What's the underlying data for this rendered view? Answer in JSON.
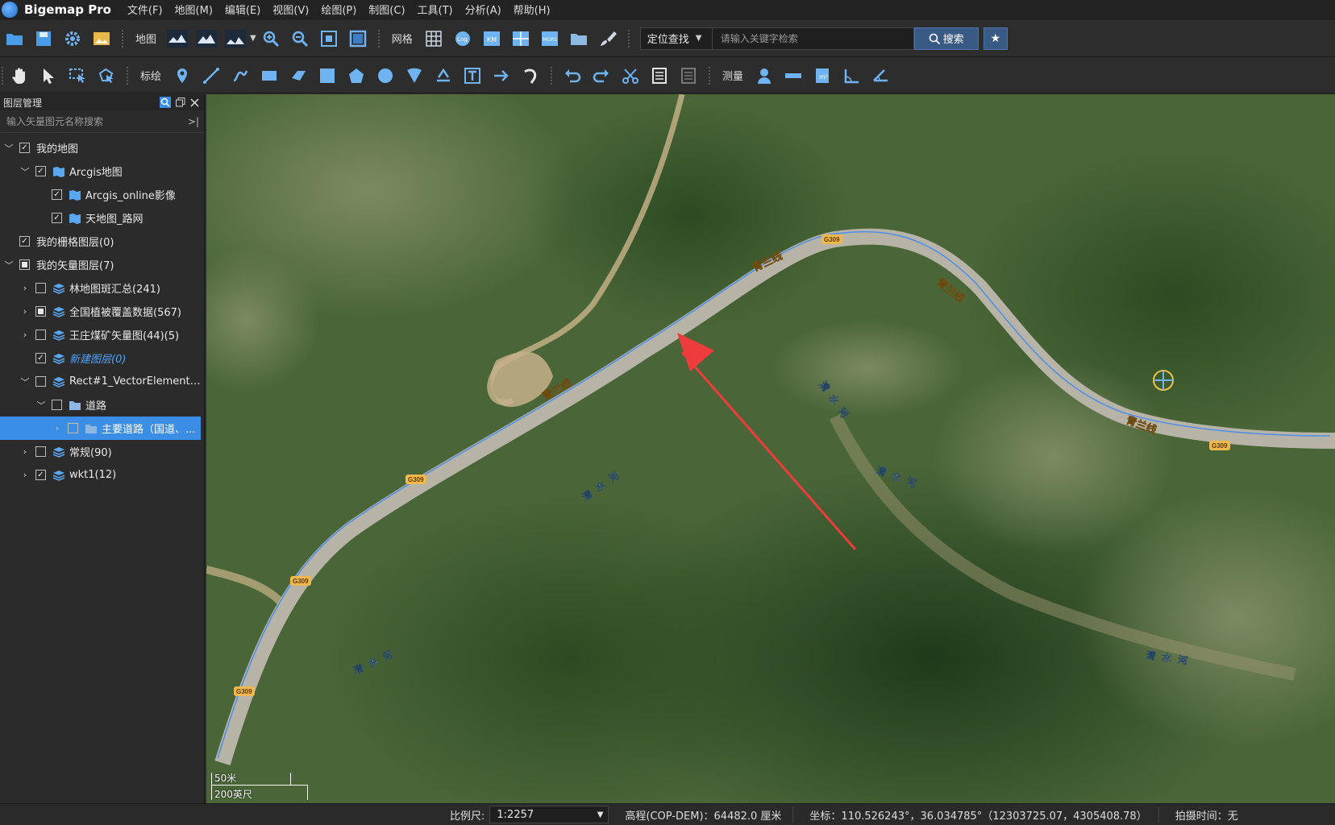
{
  "app": {
    "name": "Bigemap Pro",
    "menus": [
      "文件(F)",
      "地图(M)",
      "编辑(E)",
      "视图(V)",
      "绘图(P)",
      "制图(C)",
      "工具(T)",
      "分析(A)",
      "帮助(H)"
    ]
  },
  "toolbar1": {
    "map_label": "地图",
    "grid_label": "网格",
    "search_mode": "定位查找",
    "search_placeholder": "请输入关键字检索",
    "search_button": "搜索"
  },
  "toolbar2": {
    "draw_label": "标绘",
    "measure_label": "测量"
  },
  "sidebar": {
    "title": "图层管理",
    "search_placeholder": "输入矢量图元名称搜索",
    "tree": [
      {
        "label": "我的地图",
        "level": 0,
        "arrow": "open",
        "check": "checked",
        "icon": "none"
      },
      {
        "label": "Arcgis地图",
        "level": 1,
        "arrow": "open",
        "check": "checked",
        "icon": "map"
      },
      {
        "label": "Arcgis_online影像",
        "level": 2,
        "arrow": "none",
        "check": "checked",
        "icon": "map"
      },
      {
        "label": "天地图_路网",
        "level": 2,
        "arrow": "none",
        "check": "checked",
        "icon": "map"
      },
      {
        "label": "我的栅格图层(0)",
        "level": 0,
        "arrow": "none",
        "check": "checked",
        "icon": "none"
      },
      {
        "label": "我的矢量图层(7)",
        "level": 0,
        "arrow": "open",
        "check": "partial",
        "icon": "none"
      },
      {
        "label": "林地图斑汇总(241)",
        "level": 1,
        "arrow": "closed",
        "check": "unchecked",
        "icon": "layers"
      },
      {
        "label": "全国植被覆盖数据(567)",
        "level": 1,
        "arrow": "closed",
        "check": "partial",
        "icon": "layers"
      },
      {
        "label": "王庄煤矿矢量图(44)(5)",
        "level": 1,
        "arrow": "closed",
        "check": "unchecked",
        "icon": "layers"
      },
      {
        "label": "新建图层(0)",
        "level": 1,
        "arrow": "none",
        "check": "checked",
        "icon": "layers",
        "style": "italic-blue"
      },
      {
        "label": "Rect#1_VectorElement(...",
        "level": 1,
        "arrow": "open",
        "check": "unchecked",
        "icon": "layers"
      },
      {
        "label": "道路",
        "level": 2,
        "arrow": "open",
        "check": "unchecked",
        "icon": "folder"
      },
      {
        "label": "主要道路（国道、...",
        "level": 3,
        "arrow": "closed",
        "check": "unchecked",
        "icon": "folder",
        "selected": true
      },
      {
        "label": "常规(90)",
        "level": 1,
        "arrow": "closed",
        "check": "unchecked",
        "icon": "layers"
      },
      {
        "label": "wkt1(12)",
        "level": 1,
        "arrow": "closed",
        "check": "checked",
        "icon": "layers"
      }
    ]
  },
  "map": {
    "road_name": "青兰线",
    "road_code": "G309",
    "river_name": "清水河",
    "scale_metric": "50米",
    "scale_imperial": "200英尺",
    "road_color": "#b7b3a6",
    "route_line_color": "#4d8fe8",
    "arrow_color": "#ee3b3b"
  },
  "status": {
    "scale_label": "比例尺:",
    "scale_value": "1:2257",
    "elevation": "高程(COP-DEM)：64482.0 厘米",
    "coords": "坐标：110.526243°，36.034785°（12303725.07，4305408.78）",
    "capture_time": "拍摄时间：无"
  }
}
